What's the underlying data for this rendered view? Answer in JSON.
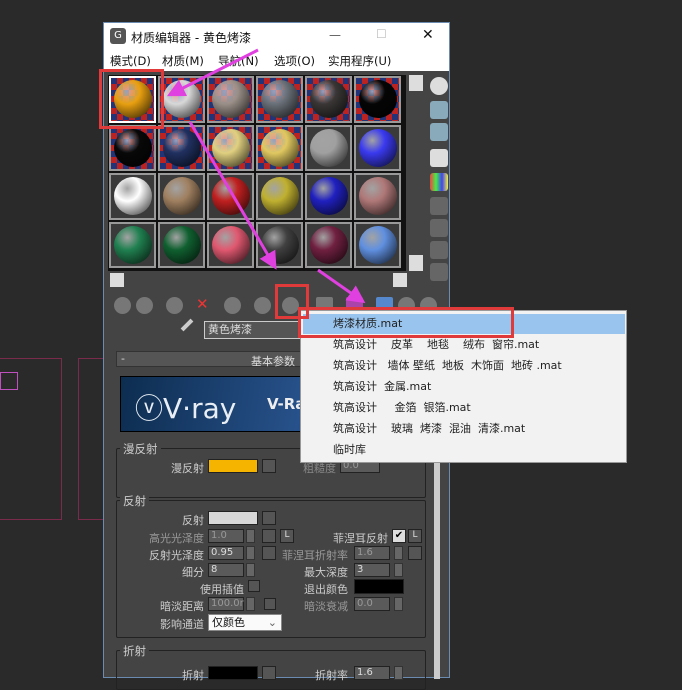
{
  "window": {
    "title": "材质编辑器 - 黄色烤漆",
    "minimize": "—",
    "maximize": "☐",
    "close": "✕"
  },
  "menu": [
    "模式(D)",
    "材质(M)",
    "导航(N)",
    "选项(O)",
    "实用程序(U)"
  ],
  "spheres": [
    [
      "#e8a010",
      "chk"
    ],
    [
      "#d8d8d8",
      "chk"
    ],
    [
      "#9a8f88",
      "chk"
    ],
    [
      "#6a7078",
      "chk"
    ],
    [
      "#3a3636",
      "chk"
    ],
    [
      "#050505",
      "chk"
    ],
    [
      "#080808",
      "chk"
    ],
    [
      "#203060",
      "chk"
    ],
    [
      "#e0d080",
      "chk"
    ],
    [
      "#e0c860",
      "chk"
    ],
    [
      "#a0a0a0",
      ""
    ],
    [
      "#3a3af0",
      ""
    ],
    [
      "#ffffff",
      ""
    ],
    [
      "#a08060",
      ""
    ],
    [
      "#c02020",
      ""
    ],
    [
      "#c0b030",
      ""
    ],
    [
      "#2020c0",
      ""
    ],
    [
      "#b07878",
      ""
    ],
    [
      "#208050",
      ""
    ],
    [
      "#106030",
      ""
    ],
    [
      "#e05870",
      ""
    ],
    [
      "#404040",
      ""
    ],
    [
      "#702040",
      ""
    ],
    [
      "#6090e0",
      ""
    ]
  ],
  "material_name": "黄色烤漆",
  "rollout_title": "基本参数",
  "vray_logo": "V·ray",
  "vray_label": "V-Ra",
  "diffuse": {
    "group": "漫反射",
    "label": "漫反射",
    "color": "#f5b400",
    "roughness_label": "粗糙度",
    "roughness": "0.0"
  },
  "reflection": {
    "group": "反射",
    "reflect_label": "反射",
    "reflect_color": "#d8d8d8",
    "hilight_label": "高光光泽度",
    "hilight": "1.0",
    "L": "L",
    "gloss_label": "反射光泽度",
    "gloss": "0.95",
    "subdivs_label": "细分",
    "subdivs": "8",
    "interp_label": "使用插值",
    "dim_label": "暗淡距离",
    "dim": "100.0r",
    "affect_label": "影响通道",
    "affect": "仅颜色",
    "fresnel_label": "菲涅耳反射",
    "fresnel_ior_label": "菲涅耳折射率",
    "fresnel_ior": "1.6",
    "maxdepth_label": "最大深度",
    "maxdepth": "3",
    "exit_label": "退出颜色",
    "falloff_label": "暗淡衰减",
    "falloff": "0.0"
  },
  "refraction": {
    "group": "折射",
    "label": "折射",
    "ior_label": "折射率",
    "ior": "1.6"
  },
  "dropdown": [
    "烤漆材质.mat",
    "筑高设计    皮革    地毯    绒布  窗帘.mat",
    "筑高设计   墙体 壁纸  地板  木饰面  地砖 .mat",
    "筑高设计  金属.mat",
    "筑高设计     金箔  银箔.mat",
    "筑高设计    玻璃  烤漆  混油  清漆.mat",
    "临时库"
  ],
  "colors": {
    "highlight": "#99c4ee",
    "annotation": "#e03a3a",
    "arrow": "#e040e0"
  }
}
